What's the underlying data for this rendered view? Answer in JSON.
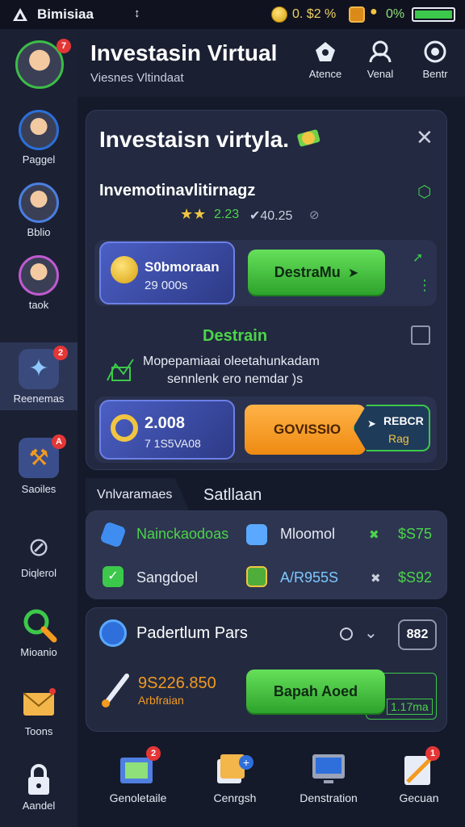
{
  "status_bar": {
    "app_name": "Bimisiaa",
    "percent_left": "0. $2 %",
    "percent_right": "0%"
  },
  "header": {
    "title": "Investasin Virtual",
    "subtitle": "Viesnes Vltindaat",
    "actions": [
      {
        "label": "Atence",
        "icon": "gamepad-icon"
      },
      {
        "label": "Venal",
        "icon": "user-icon"
      },
      {
        "label": "Bentr",
        "icon": "target-icon"
      }
    ]
  },
  "sidebar": {
    "items": [
      {
        "label": "",
        "icon": "profile-avatar-icon",
        "badge": "7"
      },
      {
        "label": "Paggel",
        "icon": "avatar-icon"
      },
      {
        "label": "Bblio",
        "icon": "avatar-hat-icon"
      },
      {
        "label": "taok",
        "icon": "avatar-icon"
      },
      {
        "label": "Reenemas",
        "icon": "sparkle-icon",
        "badge": "2"
      },
      {
        "label": "Saoiles",
        "icon": "tools-icon",
        "badge": "A"
      },
      {
        "label": "Diqlerol",
        "icon": "no-entry-icon"
      },
      {
        "label": "Mioanio",
        "icon": "magnifier-icon"
      },
      {
        "label": "Toons",
        "icon": "mail-icon"
      },
      {
        "label": "Aandel",
        "icon": "lock-icon"
      }
    ]
  },
  "modal": {
    "title": "Investaisn virtyla.",
    "subtitle": "Invemotinavlitirnagz",
    "rating_value": "2.23",
    "rating_stars": 2,
    "rating_alt": "✔40.25",
    "offer": {
      "name": "S0bmoraan",
      "amount": "29 000s",
      "cta": "DestraMu"
    },
    "section_title": "Destrain",
    "description_line1": "Mopepamiaai oleetahunkadam",
    "description_line2": "sennlenk ero nemdar )s",
    "deal": {
      "value": "2.008",
      "sub": "7 1S5VA08",
      "cta": "GOVISSIO",
      "tag1": "REBCR",
      "tag2": "Rag"
    }
  },
  "tabs": {
    "left": "Vnlvaramaes",
    "right": "Satllaan"
  },
  "market": {
    "rows": [
      [
        {
          "name": "Nainckaodoas",
          "color": "#4cd44a",
          "icon": "cube-blue-icon"
        },
        {
          "name": "Mloomol",
          "color": "#e6eaf4",
          "icon": "cube-stack-icon"
        },
        {
          "mark": "✖",
          "value": "$S75"
        }
      ],
      [
        {
          "name": "Sangdoel",
          "color": "#e6eaf4",
          "icon": "check-green-icon"
        },
        {
          "name": "A/R955S",
          "color": "#7fc7ff",
          "icon": "chip-green-icon"
        },
        {
          "mark": "✖",
          "value": "$S92"
        }
      ]
    ]
  },
  "portfolio": {
    "title": "Padertlum Pars",
    "badge": "882",
    "value": "9S226.850",
    "label": "Arbfraian",
    "cta": "Bapah Aoed",
    "mini": "1.17ma"
  },
  "bottom_nav": {
    "items": [
      {
        "label": "Genoletaile",
        "icon": "folder-icon",
        "badge": "2"
      },
      {
        "label": "Cenrgsh",
        "icon": "documents-add-icon"
      },
      {
        "label": "Denstration",
        "icon": "monitor-icon"
      },
      {
        "label": "Gecuan",
        "icon": "clipboard-icon",
        "badge": "1"
      }
    ]
  },
  "colors": {
    "accent_green": "#4cd44a",
    "accent_orange": "#f39a1f",
    "bg": "#151a2b"
  }
}
